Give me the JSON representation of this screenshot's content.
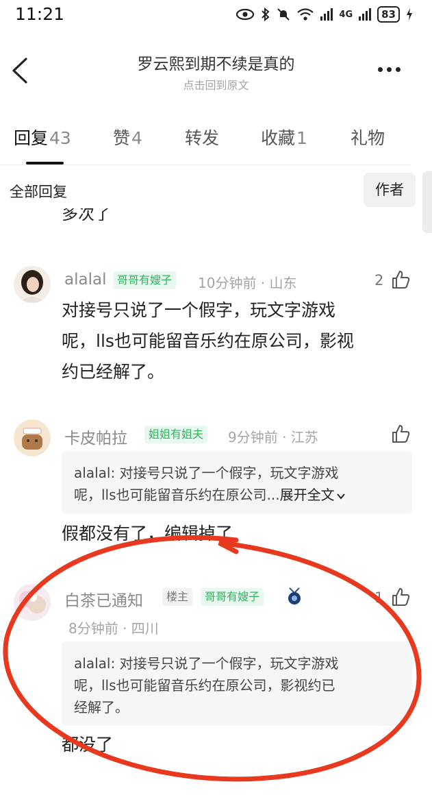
{
  "status_bar": {
    "time": "11:21",
    "network": "4G",
    "battery": "83"
  },
  "header": {
    "title": "罗云熙到期不续是真的",
    "subtitle": "点击回到原文"
  },
  "tabs": [
    {
      "label": "回复",
      "count": "43"
    },
    {
      "label": "赞",
      "count": "4"
    },
    {
      "label": "转发",
      "count": ""
    },
    {
      "label": "收藏",
      "count": "1"
    },
    {
      "label": "礼物",
      "count": ""
    }
  ],
  "filter": {
    "all_replies": "全部回复",
    "author_only": "作者"
  },
  "clipped_text": "多次了",
  "comments": [
    {
      "username": "alalal",
      "badge": "哥哥有嫂子",
      "meta": "10分钟前 · 山东",
      "likes": "2",
      "body": [
        "对接号只说了一个假字，玩文字游戏",
        "呢，lls也可能留音乐约在原公司，影视",
        "约已经解了。"
      ]
    },
    {
      "username": "卡皮帕拉",
      "badge": "姐姐有姐夫",
      "meta": "9分钟前 · 江苏",
      "likes": "",
      "quote": [
        "alalal: 对接号只说了一个假字，玩文字游戏",
        "呢，lls也可能留音乐约在原公司..."
      ],
      "expand": "展开全文",
      "body": [
        "假都没有了，编辑掉了"
      ]
    },
    {
      "username": "白茶已通知",
      "host_badge": "楼主",
      "badge": "哥哥有嫂子",
      "meta": "8分钟前 · 四川",
      "likes": "1",
      "quote": [
        "alalal: 对接号只说了一个假字，玩文字游戏",
        "呢，lls也可能留音乐约在原公司，影视约已",
        "经解了。"
      ],
      "body": [
        "都没了"
      ]
    }
  ],
  "colors": {
    "accent_green": "#2db55d",
    "annotation_red": "#e8391f"
  },
  "icons": [
    "back-arrow-icon",
    "more-icon",
    "thumb-up-icon",
    "expand-chevron-icon",
    "medal-icon",
    "eye-icon",
    "bluetooth-icon",
    "mute-bell-icon",
    "wifi-icon",
    "signal-icon"
  ]
}
